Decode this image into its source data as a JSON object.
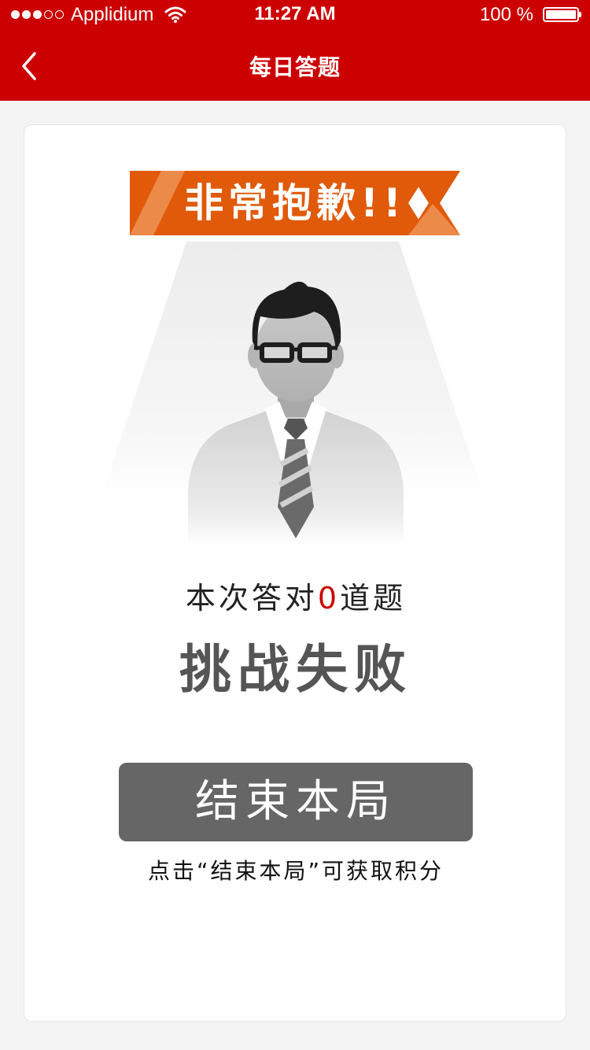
{
  "status_bar": {
    "carrier": "Applidium",
    "time": "11:27 AM",
    "battery": "100 %",
    "signal_bars": 3,
    "signal_total": 5
  },
  "nav": {
    "title": "每日答题",
    "back_icon": "chevron-left-icon"
  },
  "banner": {
    "text": "非常抱歉!!"
  },
  "result": {
    "prefix": "本次答对",
    "count": "0",
    "suffix": "道题",
    "status": "挑战失败"
  },
  "actions": {
    "end_label": "结束本局",
    "hint": "点击“结束本局”可获取积分"
  },
  "colors": {
    "header": "#cc0000",
    "ribbon": "#e05a0a",
    "ribbon_accent": "#ec8a4a",
    "button": "#666666",
    "highlight": "#cc0000"
  }
}
